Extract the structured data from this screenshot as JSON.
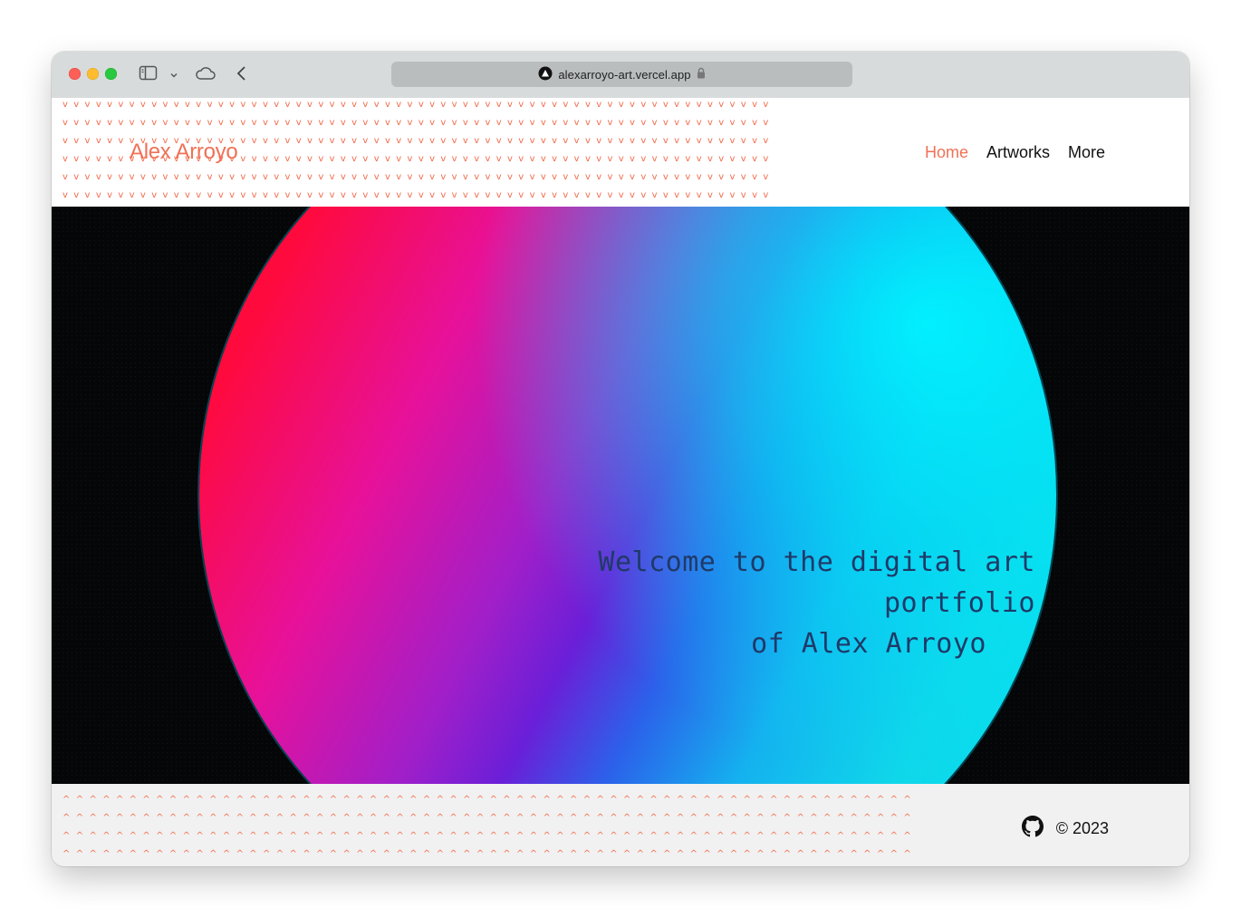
{
  "browser": {
    "url": "alexarroyo-art.vercel.app"
  },
  "site": {
    "brand": "Alex Arroyo",
    "nav": [
      {
        "label": "Home",
        "active": true
      },
      {
        "label": "Artworks",
        "active": false
      },
      {
        "label": "More",
        "active": false
      }
    ],
    "hero": {
      "line1": "Welcome to the digital art portfolio",
      "line2": "of Alex Arroyo"
    },
    "footer": {
      "copyright": "© 2023",
      "icon": "github-icon"
    }
  },
  "colors": {
    "accent": "#f07156",
    "pattern": "#f26b4b",
    "hero_bg": "#050607",
    "hero_text": "#1f3a68",
    "gradient": [
      "#ff0a3c",
      "#e7119a",
      "#6a1fd8",
      "#14b2ef",
      "#00e4f0"
    ]
  }
}
